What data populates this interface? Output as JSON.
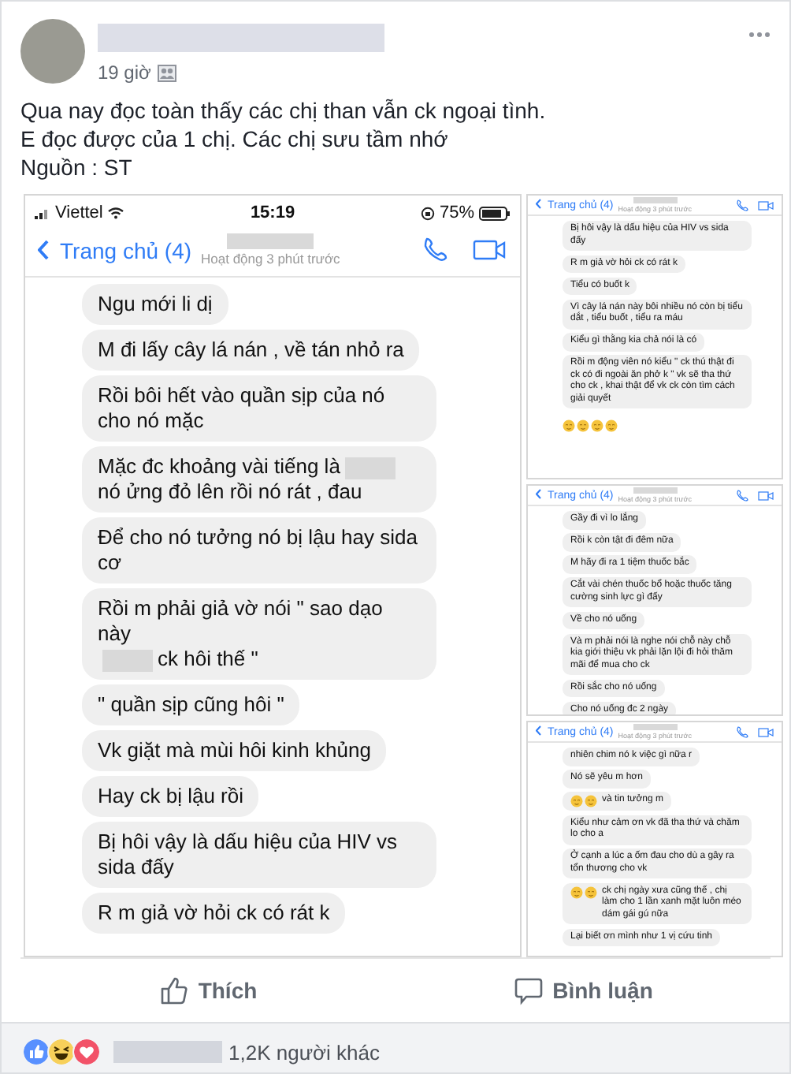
{
  "post": {
    "time": "19 giờ",
    "lines": [
      "Qua nay đọc toàn thấy các chị than vẫn ck ngoại tình.",
      "E đọc được của 1 chị. Các chị sưu tầm nhớ",
      "Nguồn : ST"
    ]
  },
  "main_screenshot": {
    "carrier": "Viettel",
    "time": "15:19",
    "battery": "75%",
    "back_label": "Trang chủ (4)",
    "status": "Hoạt động 3 phút trước",
    "messages": [
      {
        "parts": [
          "Ngu mới li dị"
        ]
      },
      {
        "parts": [
          "M đi lấy cây lá nán , về tán nhỏ ra"
        ]
      },
      {
        "parts": [
          "Rồi bôi hết vào quần sịp của nó cho nó mặc"
        ]
      },
      {
        "parts": [
          "Mặc đc khoảng vài tiếng là",
          "nó ửng đỏ lên rồi nó rát , đau"
        ]
      },
      {
        "parts": [
          "Để cho nó tưởng nó bị lậu hay sida cơ"
        ]
      },
      {
        "parts": [
          "Rồi m phải giả vờ nói \" sao dạo này",
          "ck hôi thế \""
        ]
      },
      {
        "parts": [
          "\" quần sịp cũng hôi \""
        ]
      },
      {
        "parts": [
          "Vk giặt mà mùi hôi kinh khủng"
        ]
      },
      {
        "parts": [
          "Hay ck bị lậu rồi"
        ]
      },
      {
        "parts": [
          "Bị hôi vậy là dấu hiệu của HIV vs sida đấy"
        ]
      },
      {
        "parts": [
          "R m giả vờ hỏi ck có rát k"
        ]
      }
    ]
  },
  "side_screenshots": [
    {
      "back_label": "Trang chủ (4)",
      "status": "Hoạt động 3 phút trước",
      "messages": [
        {
          "text": "Bị hôi vậy là dấu hiệu của HIV vs sida đấy"
        },
        {
          "text": "R m giả vờ hỏi ck có rát k"
        },
        {
          "text": "Tiểu có buốt k"
        },
        {
          "text": "Vì cây lá nán này bôi nhiều nó còn bị tiểu dắt , tiểu buốt , tiểu ra máu"
        },
        {
          "text": "Kiểu gì thằng kia chả nói là có"
        },
        {
          "text": "Rồi m động viên nó kiểu \" ck thú thật đi ck có đi ngoài ăn phở k \" vk sẽ tha thứ cho ck , khai thật để vk ck còn tìm cách giải quyết"
        },
        {
          "emojis": [
            {
              "kind": "sad"
            },
            {
              "kind": "sad"
            },
            {
              "kind": "sad"
            },
            {
              "kind": "sad"
            }
          ]
        }
      ]
    },
    {
      "back_label": "Trang chủ (4)",
      "status": "Hoạt động 3 phút trước",
      "messages": [
        {
          "text": "Gầy đi vì lo lắng"
        },
        {
          "text": "Rồi k còn tật đi đêm nữa"
        },
        {
          "text": "M hãy đi ra 1 tiệm thuốc bắc"
        },
        {
          "text": "Cắt vài chén thuốc bổ hoặc thuốc tăng cường sinh lực gì đấy"
        },
        {
          "text": "Về cho nó uống"
        },
        {
          "text": "Và m phải nói là nghe nói chỗ này chỗ kia giới thiệu vk phải lặn lội đi hỏi thăm mãi để mua cho ck"
        },
        {
          "text": "Rồi sắc cho nó uống"
        },
        {
          "text": "Cho nó uống đc 2 ngày"
        }
      ]
    },
    {
      "back_label": "Trang chủ (4)",
      "status": "Hoạt động 3 phút trước",
      "messages": [
        {
          "text": "nhiên chim nó k việc gì nữa r"
        },
        {
          "text": "Nó sẽ yêu m hơn"
        },
        {
          "emojis": [
            {
              "kind": "sad"
            },
            {
              "kind": "sad"
            }
          ],
          "text": "và tin tưởng m"
        },
        {
          "text": "Kiểu như cảm ơn vk đã tha thứ và chăm lo cho a"
        },
        {
          "text": "Ở cạnh a lúc a ốm đau cho dù a gây ra tổn thương cho vk"
        },
        {
          "emojis": [
            {
              "kind": "sad"
            },
            {
              "kind": "sad"
            }
          ],
          "text": "ck chị ngày xưa cũng thế , chị làm cho 1 lần xanh mặt luôn méo dám gái gú nữa"
        },
        {
          "text": "Lại biết ơn mình như 1 vị cứu tinh"
        }
      ]
    }
  ],
  "actions": [
    {
      "kind": "like",
      "label": "Thích"
    },
    {
      "kind": "comment",
      "label": "Bình luận"
    }
  ],
  "reactions": {
    "icons": [
      {
        "kind": "like"
      },
      {
        "kind": "haha"
      },
      {
        "kind": "love"
      }
    ],
    "others": "1,2K người khác"
  }
}
